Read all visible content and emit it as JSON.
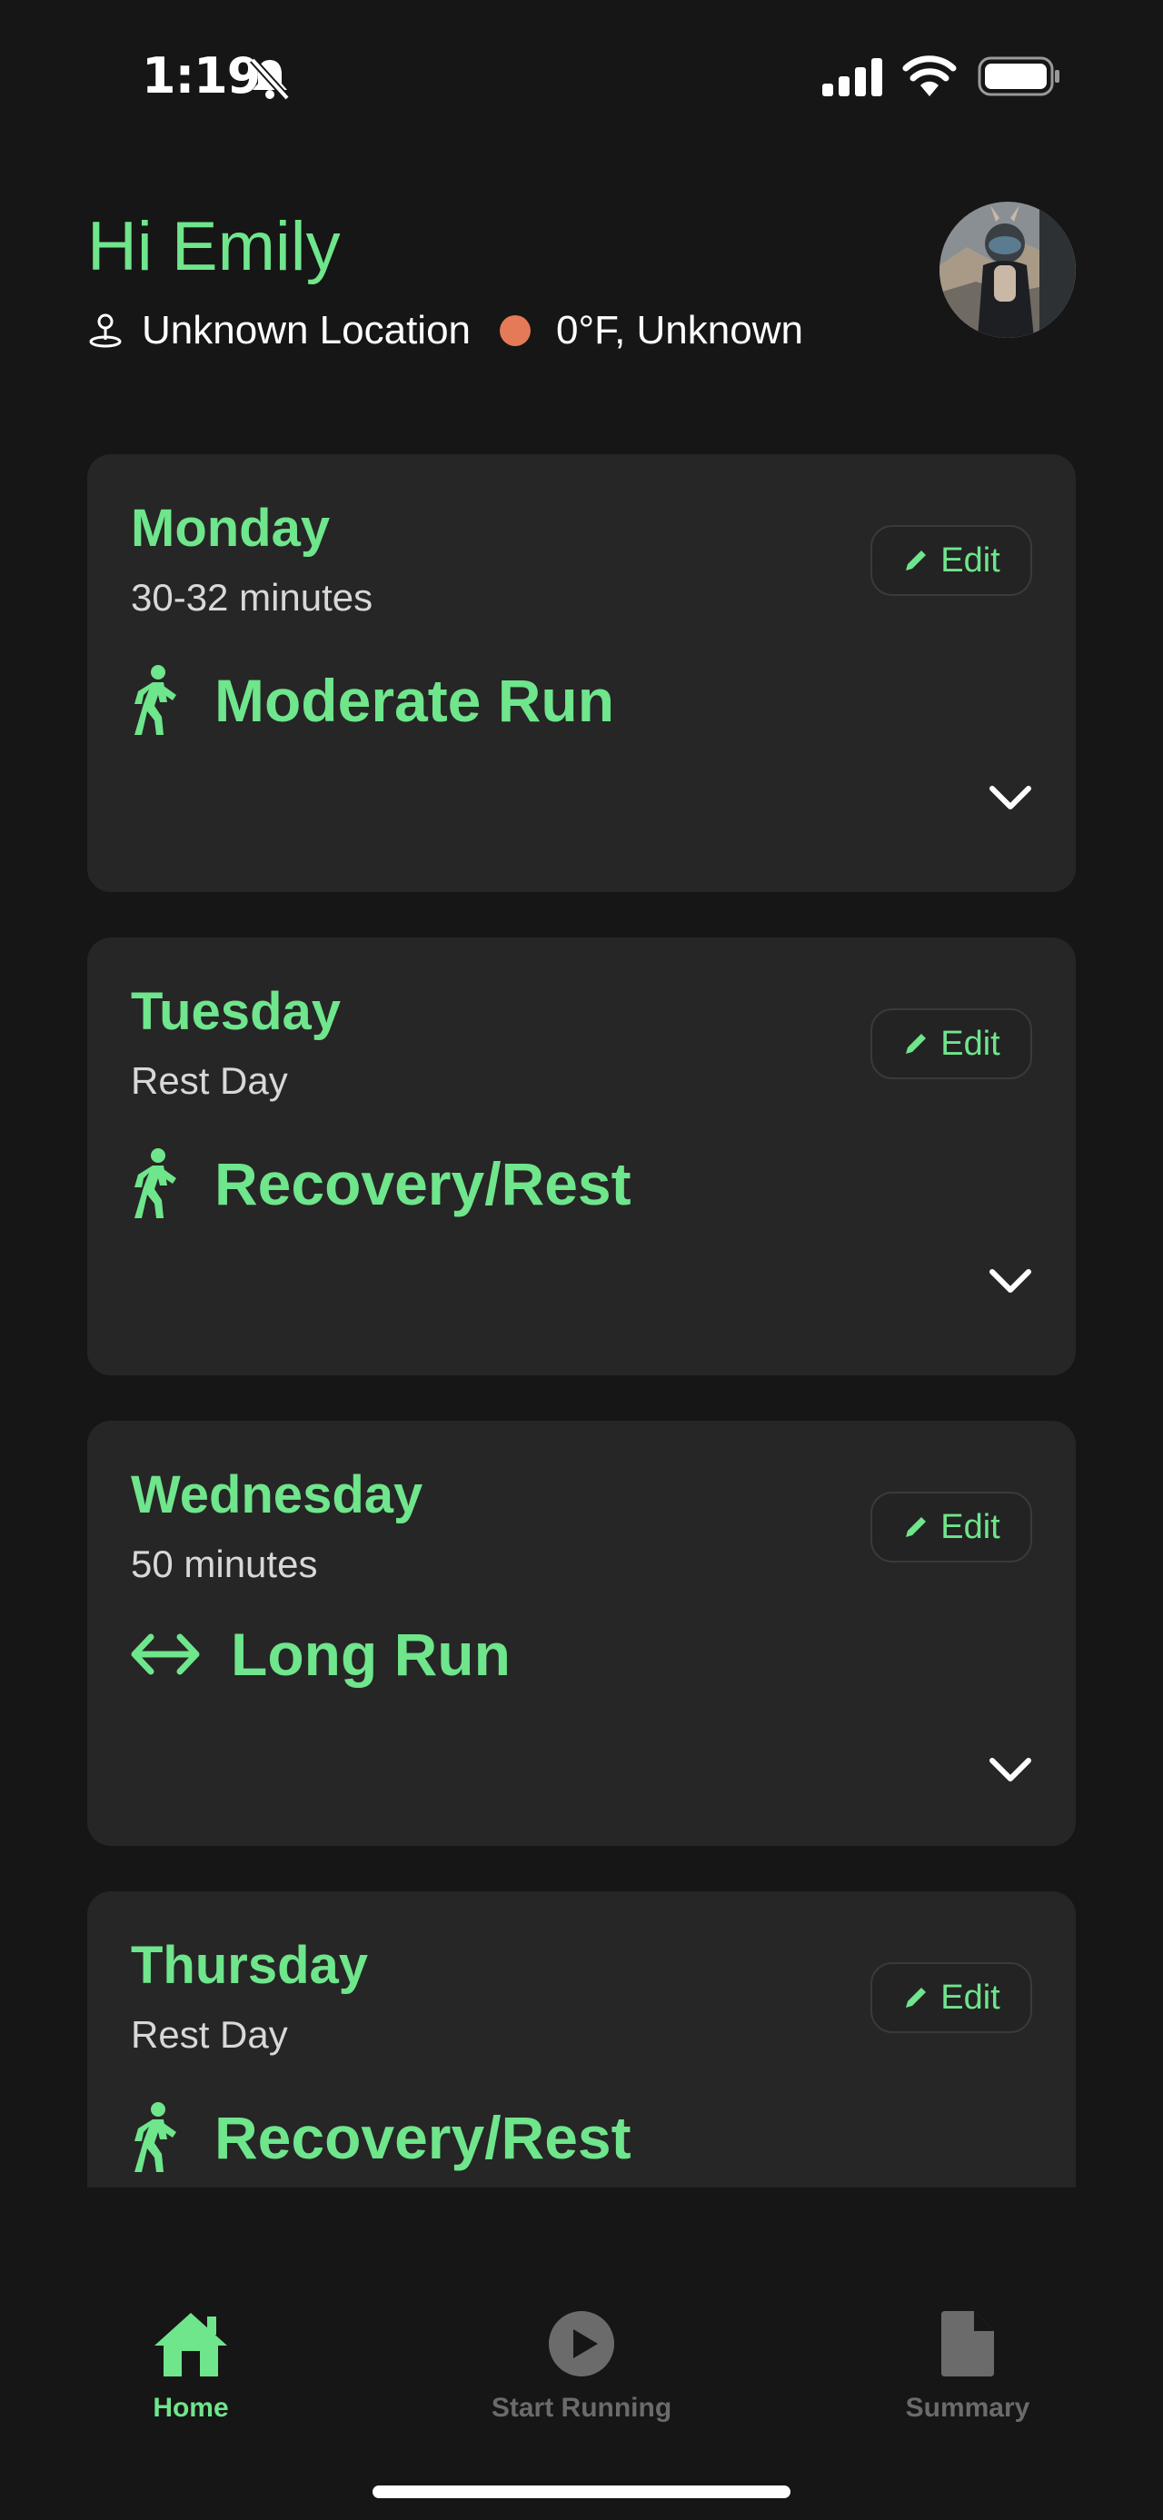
{
  "status_bar": {
    "time": "1:19"
  },
  "header": {
    "greeting": "Hi Emily",
    "location": "Unknown Location",
    "weather": "0°F, Unknown"
  },
  "edit_label": "Edit",
  "days": [
    {
      "day": "Monday",
      "detail": "30-32 minutes",
      "workout": "Moderate Run",
      "workout_icon": "walk-icon"
    },
    {
      "day": "Tuesday",
      "detail": "Rest Day",
      "workout": "Recovery/Rest",
      "workout_icon": "walk-icon"
    },
    {
      "day": "Wednesday",
      "detail": "50 minutes",
      "workout": "Long Run",
      "workout_icon": "double-arrow-icon"
    },
    {
      "day": "Thursday",
      "detail": "Rest Day",
      "workout": "Recovery/Rest",
      "workout_icon": "walk-icon"
    }
  ],
  "tabs": [
    {
      "label": "Home",
      "icon": "home-icon",
      "active": true
    },
    {
      "label": "Start Running",
      "icon": "play-circle-icon",
      "active": false
    },
    {
      "label": "Summary",
      "icon": "document-icon",
      "active": false
    }
  ],
  "colors": {
    "accent": "#6fe58c",
    "background": "#161616",
    "card": "#262626",
    "weather_dot": "#e47a57",
    "inactive": "#6b6b6b"
  }
}
